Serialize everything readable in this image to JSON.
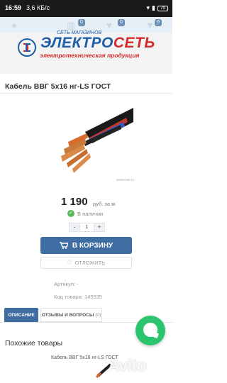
{
  "status_bar": {
    "time": "16:59",
    "speed": "3,6 КБ/с",
    "battery": "79"
  },
  "top_nav": {
    "compare_count": "0",
    "favorites_count": "0",
    "cart_count": "0"
  },
  "logo": {
    "top_text": "СЕТЬ МАГАЗИНОВ",
    "name_part1": "ЭЛЕКТРО",
    "name_part2": "СЕТЬ",
    "subtitle": "электротехническая продукция"
  },
  "product": {
    "title": "Кабель ВВГ 5х16 нг-LS ГОСТ",
    "image_caption": "elektroset.ru",
    "price": "1 190",
    "unit": "руб. за м",
    "stock": "В наличии",
    "quantity": "1",
    "qty_minus": "-",
    "qty_plus": "+",
    "cart_button": "В КОРЗИНУ",
    "defer_button": "ОТЛОЖИТЬ",
    "article": "Артикул: -",
    "product_code": "Код товара: 145535"
  },
  "tabs": {
    "description": "ОПИСАНИЕ",
    "reviews": "ОТЗЫВЫ И ВОПРОСЫ",
    "reviews_count": "(0)"
  },
  "similar": {
    "heading": "Похожие товары",
    "item": "Кабель ВВГ 5х16 нг-LS ГОСТ"
  },
  "watermark": "Avito",
  "colors": {
    "brand_blue": "#3e6ea1",
    "logo_red": "#d42a2a",
    "chat_green": "#2cc46e",
    "stock_green": "#5cb85c"
  }
}
